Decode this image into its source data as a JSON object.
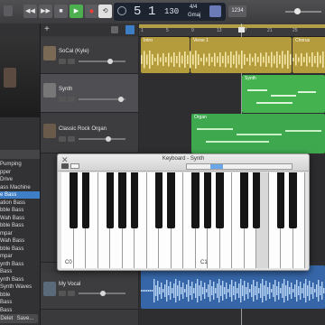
{
  "control_bar": {
    "lcd": {
      "bar": "5",
      "beat": "1",
      "tempo": "130",
      "time_signature_top": "4/4",
      "key": "Gmaj"
    },
    "count_in_label": "1234",
    "icons": [
      "rewind-icon",
      "fast-forward-icon",
      "stop-icon",
      "play-icon",
      "record-icon",
      "cycle-icon"
    ]
  },
  "library": {
    "items": [
      "Pumping",
      "pper",
      "Drive",
      "ass Machine",
      "e Bass",
      "ation Bass",
      "bble Bass",
      "Wah Bass",
      "bble Bass",
      "mpar",
      "Wah Bass",
      "bble Bass",
      "mpar",
      "ynth Bass",
      "Bass",
      "ynth Bass",
      "Synth Waves",
      "bble",
      "Bass",
      "Bass"
    ],
    "selected_index": 4,
    "delete_label": "Delete",
    "save_label": "Save..."
  },
  "tracks": [
    {
      "name": "SoCal (Kyle)",
      "color": "#c9b04a"
    },
    {
      "name": "Synth",
      "color": "#3ea84f"
    },
    {
      "name": "Classic Rock Organ",
      "color": "#3ea84f"
    },
    {
      "name": "My Vocal",
      "color": "#3e6fb0"
    }
  ],
  "regions": {
    "intro": "Intro",
    "verse": "Verse 1",
    "chorus": "Chorus",
    "synth": "Synth",
    "organ": "Organ",
    "vocal": "My Vocal"
  },
  "ruler": [
    "1",
    "5",
    "9",
    "13",
    "17",
    "21",
    "25"
  ],
  "keyboard": {
    "title": "Keyboard - Synth",
    "octave_labels": [
      "C0",
      "C1"
    ]
  }
}
